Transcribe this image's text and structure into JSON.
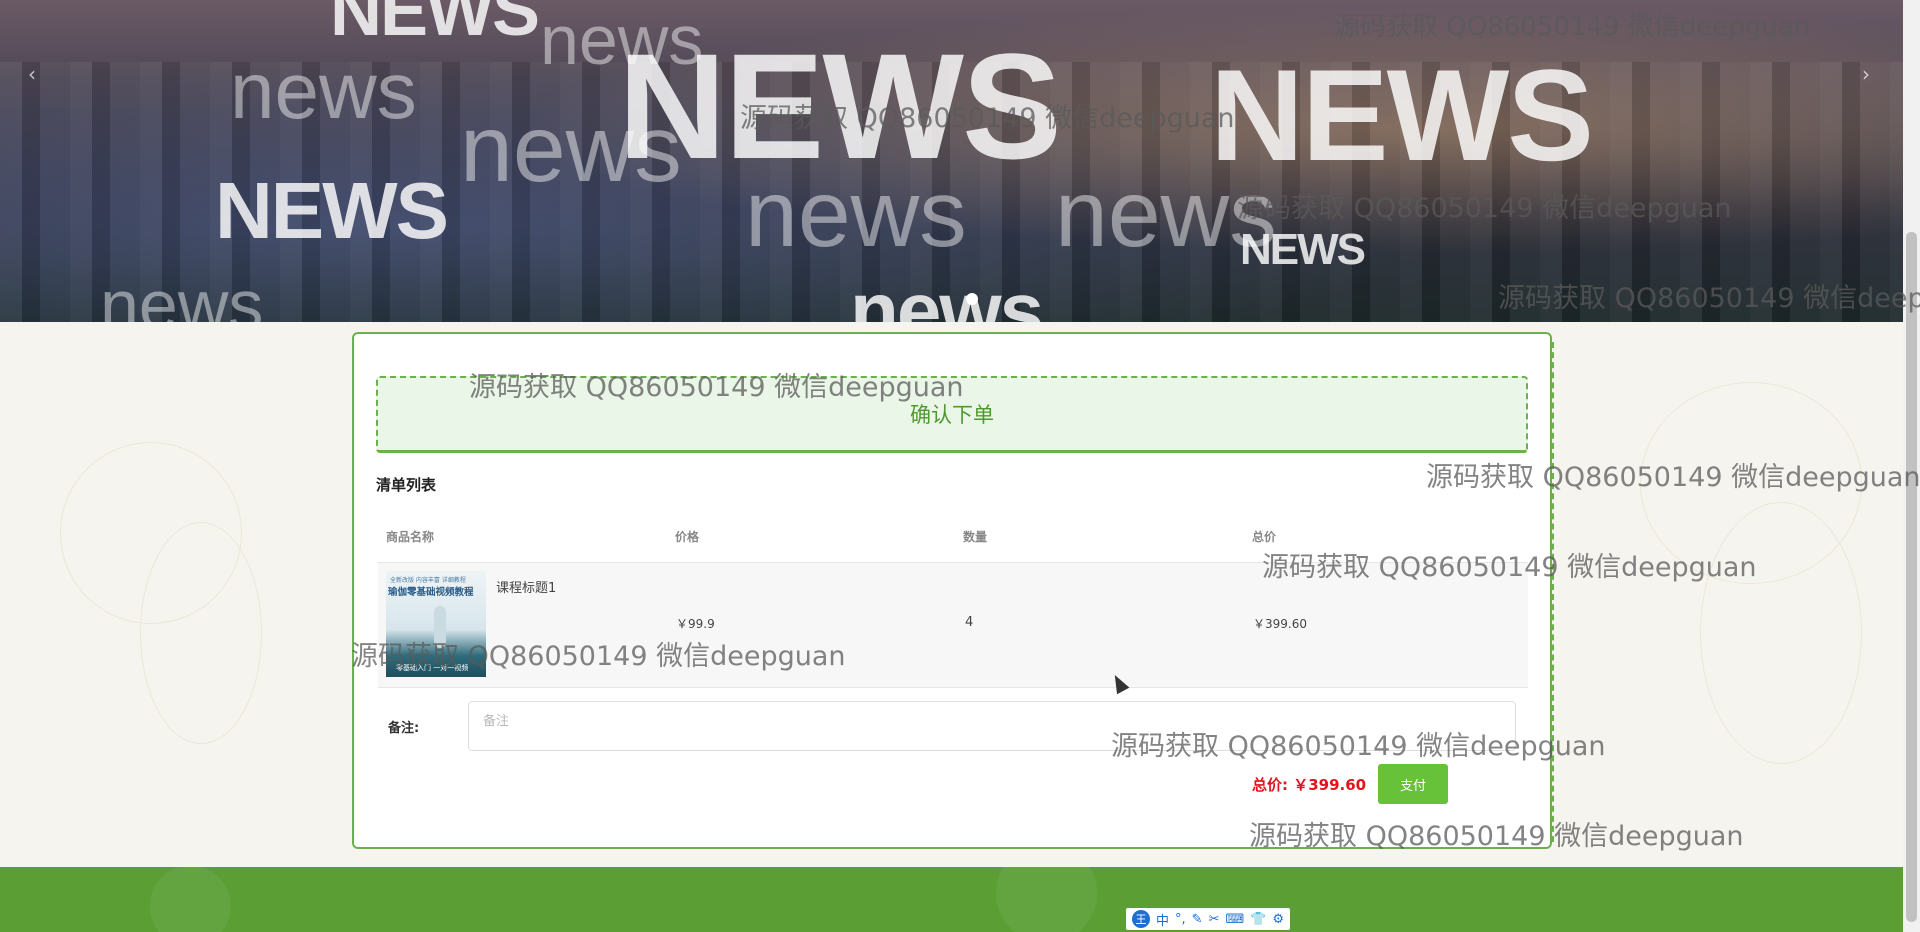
{
  "banner": {
    "words": [
      "NEWS",
      "news",
      "NEWS",
      "news",
      "NEWS",
      "news",
      "NEWS",
      "news",
      "news",
      "NEWS",
      "news",
      "news"
    ],
    "prev_arrow": "‹",
    "next_arrow": "›"
  },
  "order": {
    "confirm_title": "确认下单",
    "list_title": "清单列表",
    "columns": [
      "商品名称",
      "价格",
      "数量",
      "总价"
    ],
    "items": [
      {
        "thumb_line1": "全新改版 内容丰富 详细教程",
        "thumb_title": "瑜伽零基础视频教程",
        "thumb_footer": "零基础入门 一对一视频",
        "name": "课程标题1",
        "price": "￥99.9",
        "quantity": "4",
        "total": "￥399.60"
      }
    ],
    "remark_label": "备注:",
    "remark_placeholder": "备注",
    "grand_total": "总价: ￥399.60",
    "pay_button": "支付"
  },
  "watermark": "源码获取 QQ86050149 微信deepguan",
  "ime": {
    "logo": "王",
    "items": [
      "中",
      "°,",
      "✎",
      "✂",
      "⌨",
      "👕",
      "⚙"
    ]
  },
  "colors": {
    "accent": "#67c23a",
    "card_border": "#6ab04c",
    "price_red": "#e4131b",
    "footer_green": "#5a9e34"
  }
}
